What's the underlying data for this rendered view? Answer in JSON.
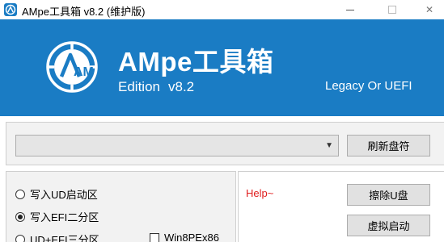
{
  "window": {
    "title": "AMpe工具箱 v8.2 (维护版)",
    "minimize_icon": "minimize-icon",
    "maximize_icon": "maximize-icon",
    "close_icon": "close-icon",
    "close_glyph": "✕"
  },
  "banner": {
    "logo_text": "AM",
    "title": "AMpe工具箱",
    "edition_label": "Edition",
    "version": "v8.2",
    "boot_mode": "Legacy Or UEFI",
    "background_color": "#1a7cc4"
  },
  "drive": {
    "selected_value": "",
    "refresh_label": "刷新盘符"
  },
  "options": {
    "write_ud_label": "写入UD启动区",
    "write_efi_label": "写入EFI二分区",
    "ud_efi_label": "UD+EFI三分区",
    "win8pe_label": "Win8PEx86",
    "selected": "write_efi"
  },
  "actions": {
    "help_text": "Help~",
    "erase_label": "擦除U盘",
    "virtual_boot_label": "虚拟启动"
  }
}
